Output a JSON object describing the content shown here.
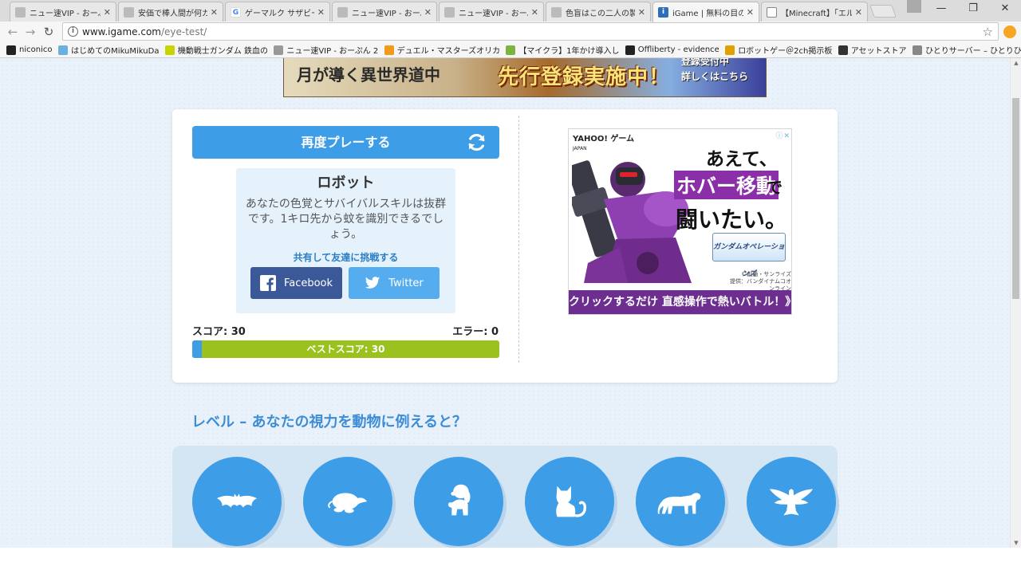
{
  "browser": {
    "tabs": [
      {
        "title": "ニュー速VIP - おーぷん",
        "favicon": "vip-face-icon",
        "active": false
      },
      {
        "title": "安価で棒人間が何カ",
        "favicon": "vip-face-icon",
        "active": false
      },
      {
        "title": "ゲーマルク サザビー - G",
        "favicon": "google-icon",
        "active": false
      },
      {
        "title": "ニュー速VIP - おーぷん",
        "favicon": "vip-face-icon",
        "active": false
      },
      {
        "title": "ニュー速VIP - おーぷん",
        "favicon": "vip-face-icon",
        "active": false
      },
      {
        "title": "色盲はこの二人の製",
        "favicon": "vip-face-icon",
        "active": false
      },
      {
        "title": "iGame | 無料の目の",
        "favicon": "igame-icon",
        "active": true
      },
      {
        "title": "【Minecraft】「エルダ",
        "favicon": "page-icon",
        "active": false
      }
    ],
    "url_host": "www.igame.com",
    "url_path": "/eye-test/",
    "bookmarks": [
      {
        "label": "niconico",
        "icon": "niconico-icon",
        "color": "#222222"
      },
      {
        "label": "はじめてのMikuMikuDa",
        "icon": "mmd-icon",
        "color": "#6ab0e0"
      },
      {
        "label": "機動戦士ガンダム 鉄血の",
        "icon": "gundam-icon",
        "color": "#c8d400"
      },
      {
        "label": "ニュー速VIP - おーぷん 2",
        "icon": "vip-face-icon",
        "color": "#999999"
      },
      {
        "label": "デュエル・マスターズオリカ",
        "icon": "duelmasters-icon",
        "color": "#f29a1a"
      },
      {
        "label": "【マイクラ】1年かけ導入し",
        "icon": "minecraft-icon",
        "color": "#7cb342"
      },
      {
        "label": "Offliberty - evidence",
        "icon": "power-icon",
        "color": "#222222"
      },
      {
        "label": "ロボットゲー＠2ch掲示板",
        "icon": "2ch-icon",
        "color": "#e0a000"
      },
      {
        "label": "アセットストア",
        "icon": "unity-icon",
        "color": "#333333"
      },
      {
        "label": "ひとりサーバー – ひとりひ",
        "icon": "page-icon",
        "color": "#888888"
      }
    ]
  },
  "banner": {
    "left_text": "月が導く異世界道中",
    "center_text": "先行登録実施中！",
    "right_line1": "登録受付中",
    "right_line2": "詳しくはこちら"
  },
  "game": {
    "replay_label": "再度プレーする",
    "result_title": "ロボット",
    "result_desc": "あなたの色覚とサバイバルスキルは抜群です。1キロ先から蚊を識別できるでしょう。",
    "share_prompt": "共有して友達に挑戦する",
    "facebook_label": "Facebook",
    "twitter_label": "Twitter",
    "score_text": "スコア: 30",
    "error_text": "エラー: 0",
    "best_score_text": "ベストスコア: 30",
    "progress_fraction": 0.03
  },
  "ad": {
    "brand": "YAHOO! ゲーム",
    "brand_sub": "JAPAN",
    "close_marks": "ⓘ✕",
    "line1": "あえて、",
    "line2": "ホバー移動",
    "line2b": "で",
    "line3": "闘いたい。",
    "badge": "ガンダムオペレーションズ",
    "credit1": "©創通・サンライズ",
    "credit2": "提供：バンダイナムコオンライン",
    "cta": "クリックするだけ 直感操作で熱いバトル！》"
  },
  "level": {
    "title": "レベル – あなたの視力を動物に例えると？",
    "animals": [
      {
        "name": "bat-icon"
      },
      {
        "name": "mole-icon"
      },
      {
        "name": "dog-icon"
      },
      {
        "name": "cat-icon"
      },
      {
        "name": "lioness-icon"
      },
      {
        "name": "eagle-icon"
      }
    ]
  },
  "colors": {
    "primary_blue": "#3d9de6",
    "best_bar_green": "#9ac11d",
    "facebook": "#3b5998",
    "twitter": "#55acee",
    "heading_blue": "#3c8cd6"
  }
}
